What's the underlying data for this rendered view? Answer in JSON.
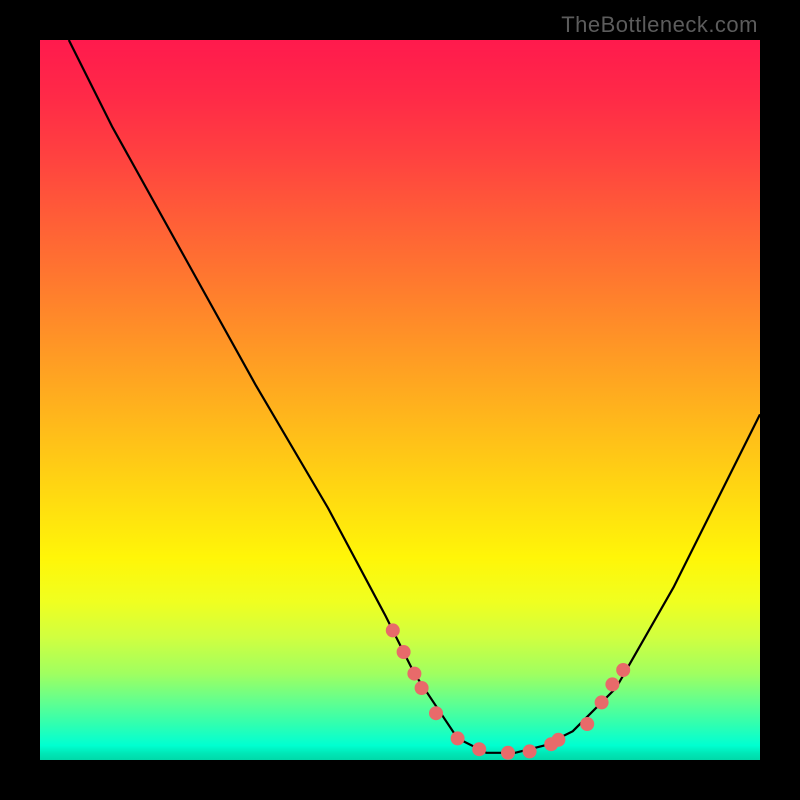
{
  "watermark": "TheBottleneck.com",
  "chart_data": {
    "type": "line",
    "title": "",
    "xlabel": "",
    "ylabel": "",
    "xlim": [
      0,
      100
    ],
    "ylim": [
      0,
      100
    ],
    "series": [
      {
        "name": "curve",
        "x": [
          4,
          10,
          20,
          30,
          40,
          48,
          52,
          56,
          58,
          62,
          66,
          70,
          74,
          80,
          88,
          96,
          100
        ],
        "y": [
          100,
          88,
          70,
          52,
          35,
          20,
          12,
          6,
          3,
          1,
          1,
          2,
          4,
          10,
          24,
          40,
          48
        ]
      },
      {
        "name": "dots",
        "type": "scatter",
        "x": [
          49,
          50.5,
          52,
          53,
          55,
          58,
          61,
          65,
          68,
          71,
          72,
          76,
          78,
          79.5,
          81
        ],
        "y": [
          18,
          15,
          12,
          10,
          6.5,
          3,
          1.5,
          1,
          1.2,
          2.2,
          2.8,
          5,
          8,
          10.5,
          12.5
        ]
      }
    ],
    "colors": {
      "curve": "#000000",
      "dots": "#e86a6a",
      "gradient_top": "#ff1a4d",
      "gradient_bottom": "#00d8a8"
    }
  }
}
